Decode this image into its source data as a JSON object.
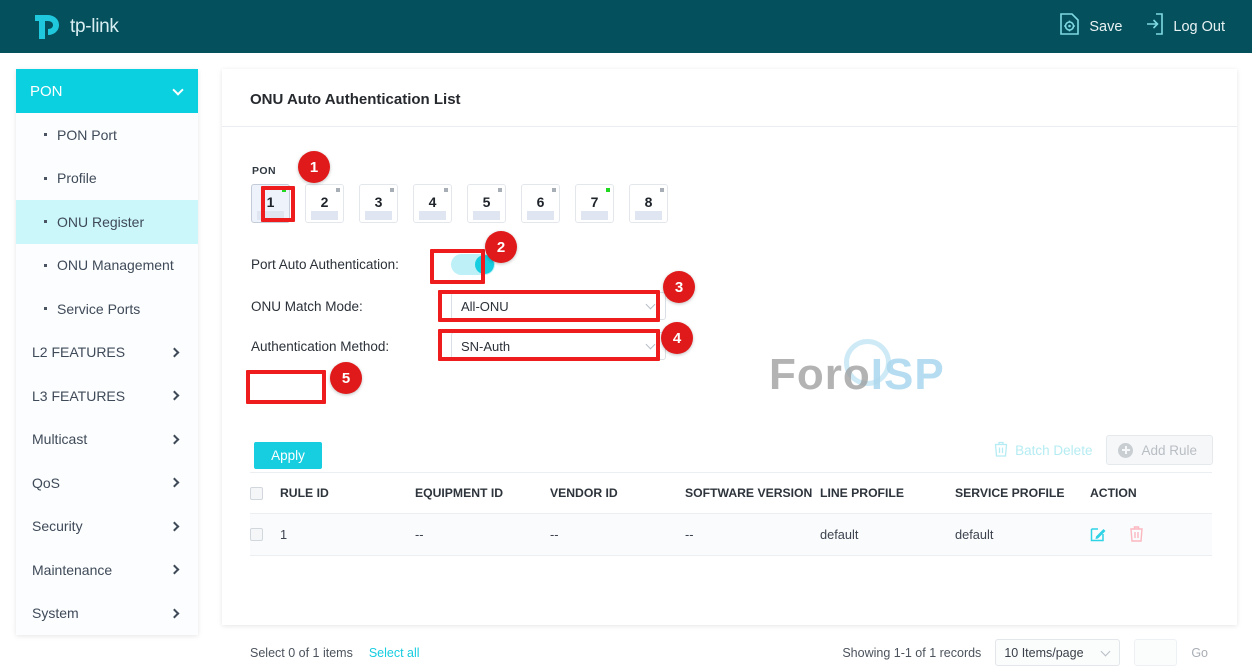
{
  "header": {
    "brand": "tp-link",
    "save_label": "Save",
    "logout_label": "Log Out"
  },
  "sidebar": {
    "group_label": "PON",
    "sub_items": [
      {
        "label": "PON Port",
        "active": false
      },
      {
        "label": "Profile",
        "active": false
      },
      {
        "label": "ONU Register",
        "active": true
      },
      {
        "label": "ONU Management",
        "active": false
      },
      {
        "label": "Service Ports",
        "active": false
      }
    ],
    "top_items": [
      {
        "label": "L2 FEATURES"
      },
      {
        "label": "L3 FEATURES"
      },
      {
        "label": "Multicast"
      },
      {
        "label": "QoS"
      },
      {
        "label": "Security"
      },
      {
        "label": "Maintenance"
      },
      {
        "label": "System"
      }
    ]
  },
  "panel": {
    "title": "ONU Auto Authentication List",
    "pon_label": "PON",
    "ports": [
      {
        "num": "1",
        "status": "on",
        "selected": true
      },
      {
        "num": "2",
        "status": "off",
        "selected": false
      },
      {
        "num": "3",
        "status": "off",
        "selected": false
      },
      {
        "num": "4",
        "status": "off",
        "selected": false
      },
      {
        "num": "5",
        "status": "off",
        "selected": false
      },
      {
        "num": "6",
        "status": "off",
        "selected": false
      },
      {
        "num": "7",
        "status": "on",
        "selected": false
      },
      {
        "num": "8",
        "status": "off",
        "selected": false
      }
    ],
    "form": {
      "auto_auth_label": "Port Auto Authentication:",
      "auto_auth_value": "on",
      "match_mode_label": "ONU Match Mode:",
      "match_mode_value": "All-ONU",
      "auth_method_label": "Authentication Method:",
      "auth_method_value": "SN-Auth",
      "apply_label": "Apply"
    }
  },
  "toolbar": {
    "batch_delete_label": "Batch Delete",
    "add_rule_label": "Add Rule"
  },
  "table": {
    "columns": [
      "RULE ID",
      "EQUIPMENT ID",
      "VENDOR ID",
      "SOFTWARE VERSION",
      "LINE PROFILE",
      "SERVICE PROFILE",
      "ACTION"
    ],
    "rows": [
      {
        "rule_id": "1",
        "equipment_id": "--",
        "vendor_id": "--",
        "software_version": "--",
        "line_profile": "default",
        "service_profile": "default"
      }
    ]
  },
  "footer": {
    "select_count": "Select 0 of 1 items",
    "select_all": "Select all",
    "showing": "Showing 1-1 of 1 records",
    "page_size": "10 Items/page",
    "page_input_value": "",
    "go_label": "Go"
  },
  "watermark": {
    "part_a": "Foro",
    "part_b": "ISP"
  },
  "annotations": [
    {
      "badge": "1"
    },
    {
      "badge": "2"
    },
    {
      "badge": "3"
    },
    {
      "badge": "4"
    },
    {
      "badge": "5"
    }
  ],
  "colors": {
    "header_bg": "#04505c",
    "accent": "#17cde0",
    "accent_light": "#cbf7fb",
    "annotation_red": "#ee1c1c",
    "status_on": "#1fd81f",
    "status_off": "#a8aeb6"
  }
}
